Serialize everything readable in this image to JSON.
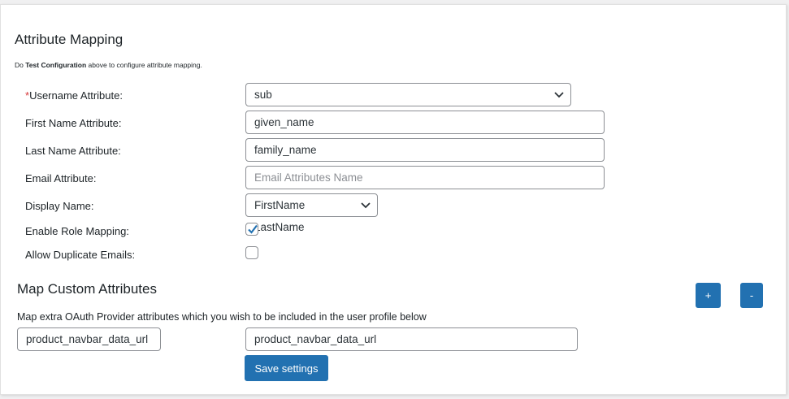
{
  "attribute_mapping": {
    "title": "Attribute Mapping",
    "note_prefix": "Do ",
    "note_bold": "Test Configuration",
    "note_suffix": " above to configure attribute mapping.",
    "username": {
      "required_mark": "*",
      "label": "Username Attribute:",
      "value": "sub"
    },
    "first_name": {
      "label": "First Name Attribute:",
      "value": "given_name"
    },
    "last_name": {
      "label": "Last Name Attribute:",
      "value": "family_name"
    },
    "email": {
      "label": "Email Attribute:",
      "value": "",
      "placeholder": "Email Attributes Name"
    },
    "display_name": {
      "label": "Display Name:",
      "value": "FirstName LastName"
    },
    "role_mapping": {
      "label": "Enable Role Mapping:",
      "checked": true
    },
    "duplicate_emails": {
      "label": "Allow Duplicate Emails:",
      "checked": false
    }
  },
  "custom_attributes": {
    "title": "Map Custom Attributes",
    "description": "Map extra OAuth Provider attributes which you wish to be included in the user profile below",
    "add_label": "+",
    "remove_label": "-",
    "rows": [
      {
        "key": "product_navbar_data_url",
        "value": "product_navbar_data_url"
      }
    ],
    "save_label": "Save settings"
  },
  "colors": {
    "primary": "#2271b1",
    "required": "#d63638"
  }
}
